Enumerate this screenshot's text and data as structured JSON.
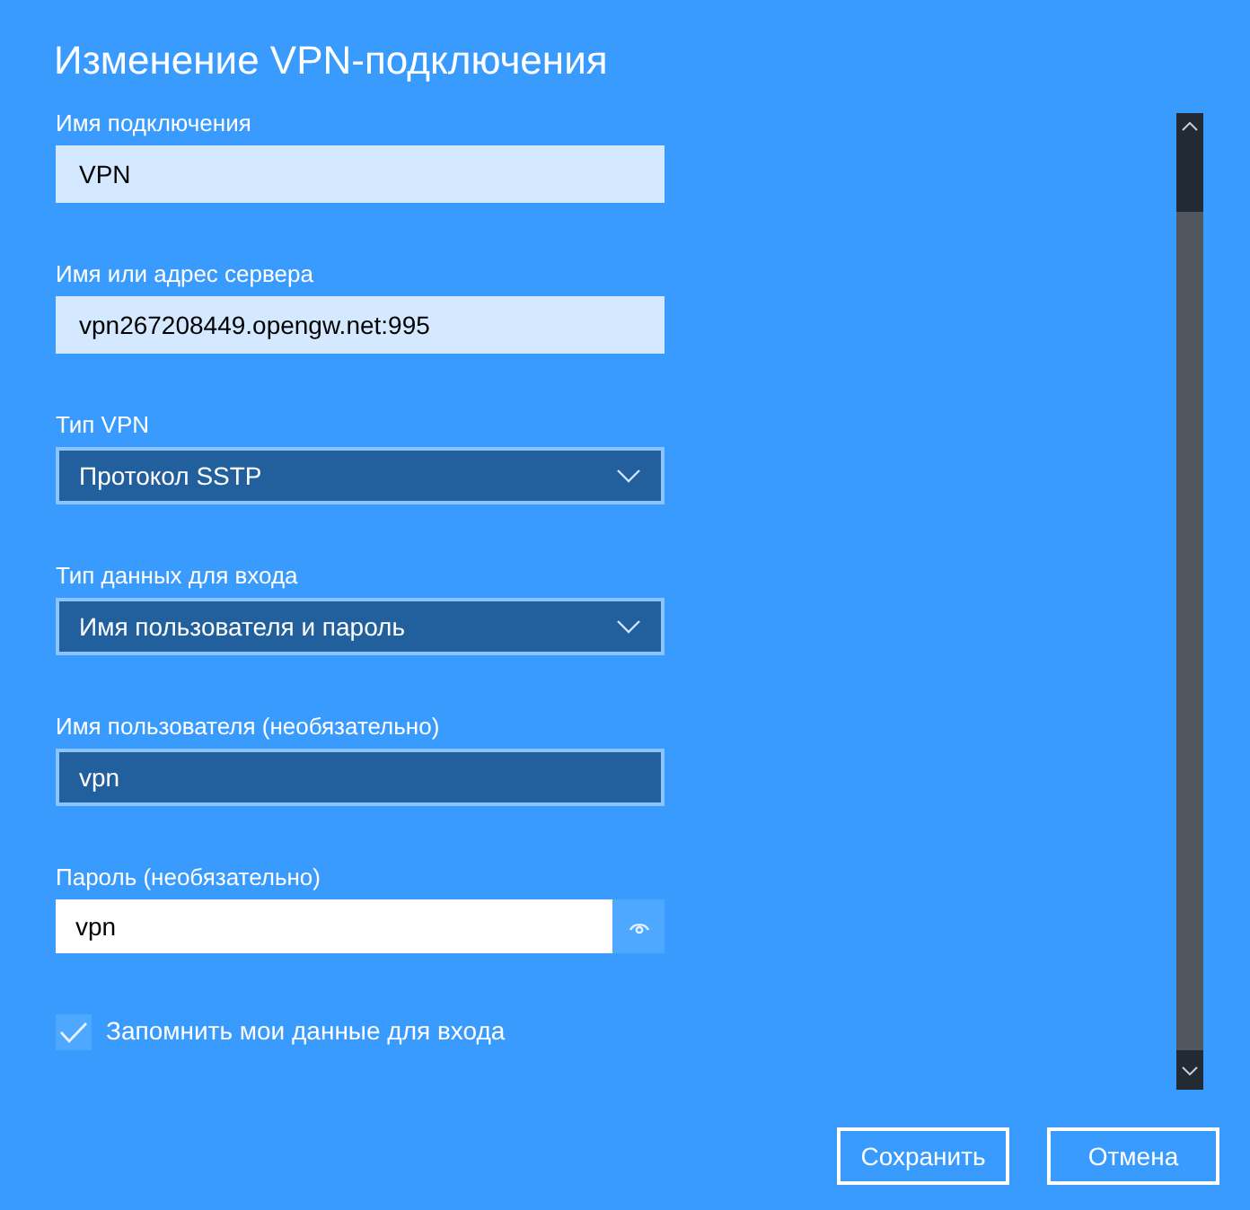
{
  "title": "Изменение VPN-подключения",
  "fields": [
    {
      "kind": "text",
      "label": "Имя подключения",
      "value": "VPN",
      "highlighted": false
    },
    {
      "kind": "text",
      "label": "Имя или адрес сервера",
      "value": "vpn267208449.opengw.net:995",
      "highlighted": false
    },
    {
      "kind": "select",
      "label": "Тип VPN",
      "value": "Протокол SSTP"
    },
    {
      "kind": "select",
      "label": "Тип данных для входа",
      "value": "Имя пользователя и пароль"
    },
    {
      "kind": "text",
      "label": "Имя пользователя (необязательно)",
      "value": "vpn",
      "highlighted": true
    },
    {
      "kind": "password",
      "label": "Пароль (необязательно)",
      "value": "vpn"
    }
  ],
  "remember": {
    "label": "Запомнить мои данные для входа",
    "checked": true
  },
  "buttons": [
    "Сохранить",
    "Отмена"
  ]
}
